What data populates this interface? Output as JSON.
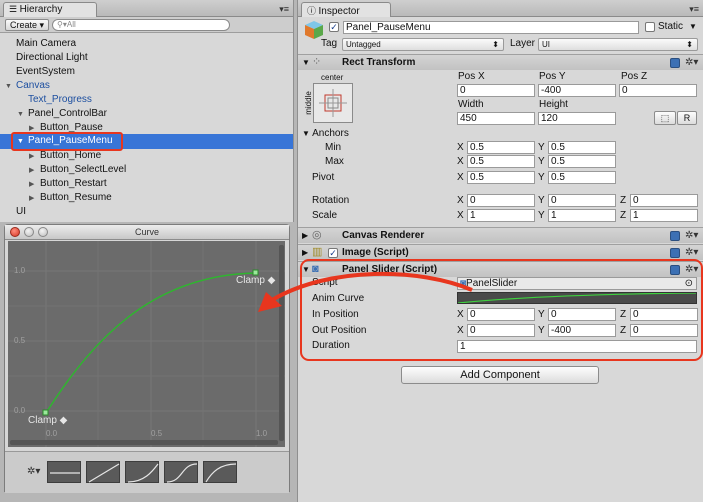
{
  "hierarchy": {
    "tab_label": "Hierarchy",
    "create_label": "Create",
    "search_placeholder": "All",
    "items": [
      {
        "label": "Main Camera"
      },
      {
        "label": "Directional Light"
      },
      {
        "label": "EventSystem"
      },
      {
        "label": "Canvas"
      },
      {
        "label": "Text_Progress"
      },
      {
        "label": "Panel_ControlBar"
      },
      {
        "label": "Button_Pause"
      },
      {
        "label": "Panel_PauseMenu"
      },
      {
        "label": "Button_Home"
      },
      {
        "label": "Button_SelectLevel"
      },
      {
        "label": "Button_Restart"
      },
      {
        "label": "Button_Resume"
      },
      {
        "label": "UI"
      }
    ]
  },
  "curve_window": {
    "title": "Curve",
    "clamp_start": "Clamp ◆",
    "clamp_end": "Clamp ◆",
    "y_ticks": [
      "1.0",
      "0.5",
      "0.0"
    ],
    "x_ticks": [
      "0.0",
      "0.5",
      "1.0"
    ],
    "curve_color": "#2fb52f"
  },
  "inspector": {
    "tab_label": "Inspector",
    "object_name": "Panel_PauseMenu",
    "static_label": "Static",
    "tag_label": "Tag",
    "tag_value": "Untagged",
    "layer_label": "Layer",
    "layer_value": "UI",
    "rect_transform": {
      "title": "Rect Transform",
      "anchor_preset_top": "center",
      "anchor_preset_side": "middle",
      "pos_x_label": "Pos X",
      "pos_y_label": "Pos Y",
      "pos_z_label": "Pos Z",
      "pos_x": "0",
      "pos_y": "-400",
      "pos_z": "0",
      "width_label": "Width",
      "height_label": "Height",
      "width": "450",
      "height": "120",
      "r_button": "R",
      "anchors_label": "Anchors",
      "min_label": "Min",
      "max_label": "Max",
      "min_x": "0.5",
      "min_y": "0.5",
      "max_x": "0.5",
      "max_y": "0.5",
      "pivot_label": "Pivot",
      "pivot_x": "0.5",
      "pivot_y": "0.5",
      "rotation_label": "Rotation",
      "rot_x": "0",
      "rot_y": "0",
      "rot_z": "0",
      "scale_label": "Scale",
      "scale_x": "1",
      "scale_y": "1",
      "scale_z": "1"
    },
    "canvas_renderer": {
      "title": "Canvas Renderer"
    },
    "image_script": {
      "title": "Image (Script)"
    },
    "panel_slider": {
      "title": "Panel Slider (Script)",
      "script_label": "Script",
      "script_value": "PanelSlider",
      "anim_curve_label": "Anim Curve",
      "in_position_label": "In Position",
      "in_x": "0",
      "in_y": "0",
      "in_z": "0",
      "out_position_label": "Out Position",
      "out_x": "0",
      "out_y": "-400",
      "out_z": "0",
      "duration_label": "Duration",
      "duration": "1"
    },
    "add_component_label": "Add Component"
  },
  "axis_letters": {
    "x": "X",
    "y": "Y",
    "z": "Z"
  },
  "highlight_color": "#e8361e",
  "selection_color": "#3875d7"
}
